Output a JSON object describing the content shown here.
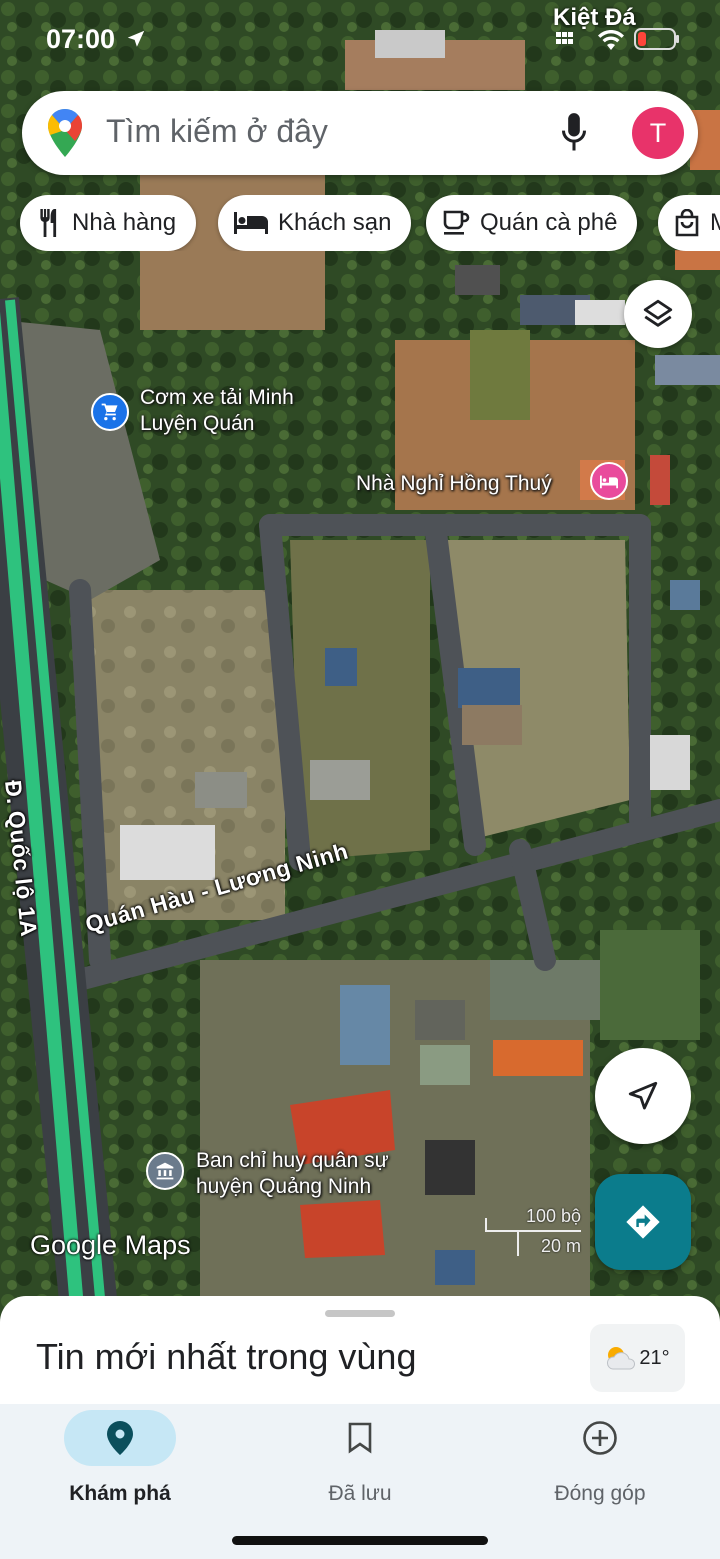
{
  "status_bar": {
    "time": "07:00",
    "location_label": "Kiệt Đá",
    "icons": [
      "location-arrow-icon",
      "cellular-icon",
      "wifi-icon",
      "battery-icon"
    ]
  },
  "search": {
    "placeholder": "Tìm kiếm ở đây",
    "avatar_letter": "T",
    "avatar_color": "#e8336a"
  },
  "chips": [
    {
      "label": "Nhà hàng",
      "icon": "restaurant-icon"
    },
    {
      "label": "Khách sạn",
      "icon": "hotel-icon"
    },
    {
      "label": "Quán cà phê",
      "icon": "cafe-icon"
    },
    {
      "label": "M",
      "icon": "shopping-icon"
    }
  ],
  "map": {
    "places": [
      {
        "line1": "Cơm xe tải Minh",
        "line2": "Luyện Quán",
        "icon": "shopping-cart-icon",
        "color": "#1a73e8"
      },
      {
        "line1": "Nhà Nghỉ Hồng Thuý",
        "icon": "bed-icon",
        "color": "#e94b9c"
      },
      {
        "line1": "Ban chỉ huy quân sự",
        "line2": "huyện Quảng Ninh",
        "icon": "government-icon",
        "color": "#6b7b8c"
      }
    ],
    "roads": {
      "highway": "Đ. Quốc lộ 1A",
      "street": "Quán Hàu - Lương Ninh"
    },
    "scale": {
      "top": "100 bộ",
      "bottom": "20 m"
    },
    "brand": "Google Maps"
  },
  "sheet": {
    "title": "Tin mới nhất trong vùng",
    "temperature": "21°",
    "weather_icon": "partly-cloudy-icon"
  },
  "nav": [
    {
      "label": "Khám phá",
      "icon": "explore-pin-icon",
      "active": true
    },
    {
      "label": "Đã lưu",
      "icon": "bookmark-icon",
      "active": false
    },
    {
      "label": "Đóng góp",
      "icon": "add-circle-icon",
      "active": false
    }
  ],
  "colors": {
    "accent": "#0b7c8c",
    "nav_active": "#c6e7f5",
    "highway": "#2ec27e"
  }
}
